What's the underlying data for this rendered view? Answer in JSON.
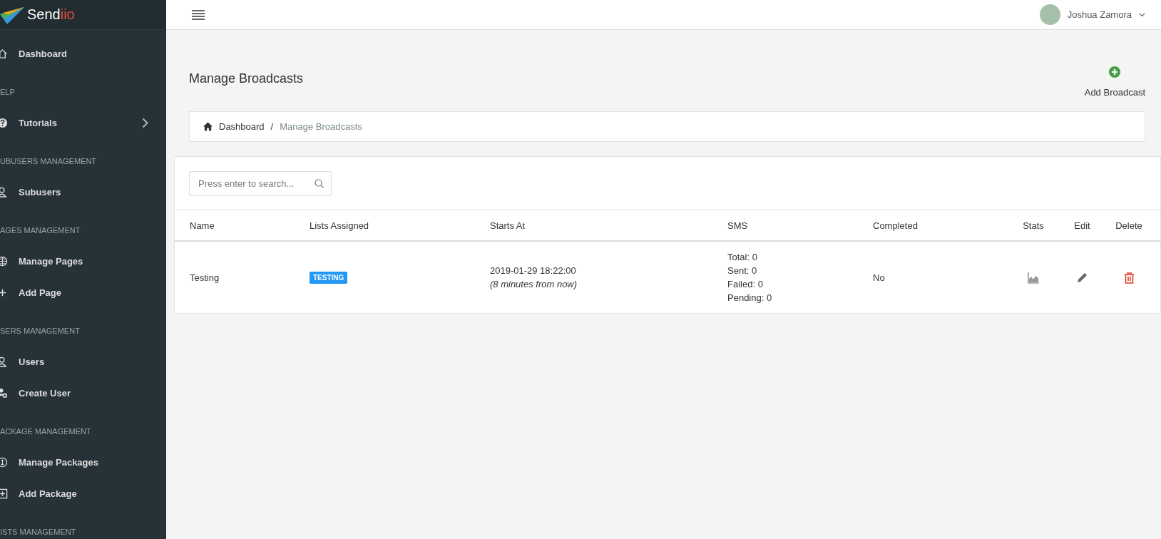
{
  "sidebar": {
    "logo": {
      "text": "Send",
      "accent": "iio"
    },
    "items": [
      {
        "kind": "item",
        "label": "Dashboard",
        "submenu": false
      },
      {
        "kind": "header",
        "label": "ELP"
      },
      {
        "kind": "item",
        "label": "Tutorials",
        "submenu": true
      },
      {
        "kind": "header",
        "label": "UBUSERS MANAGEMENT"
      },
      {
        "kind": "item",
        "label": "Subusers",
        "submenu": false
      },
      {
        "kind": "header",
        "label": "AGES MANAGEMENT"
      },
      {
        "kind": "item",
        "label": "Manage Pages",
        "submenu": false
      },
      {
        "kind": "item",
        "label": "Add Page",
        "submenu": false
      },
      {
        "kind": "header",
        "label": "SERS MANAGEMENT"
      },
      {
        "kind": "item",
        "label": "Users",
        "submenu": false
      },
      {
        "kind": "item",
        "label": "Create User",
        "submenu": false
      },
      {
        "kind": "header",
        "label": "ACKAGE MANAGEMENT"
      },
      {
        "kind": "item",
        "label": "Manage Packages",
        "submenu": false
      },
      {
        "kind": "item",
        "label": "Add Package",
        "submenu": false
      },
      {
        "kind": "header",
        "label": "ISTS MANAGEMENT"
      }
    ]
  },
  "topbar": {
    "user": "Joshua Zamora"
  },
  "page": {
    "title": "Manage Broadcasts",
    "add_button": "Add Broadcast",
    "breadcrumb": {
      "items": [
        "Dashboard",
        "Manage Broadcasts"
      ],
      "separator": "/"
    },
    "search": {
      "placeholder": "Press enter to search..."
    },
    "table": {
      "columns": [
        "Name",
        "Lists Assigned",
        "Starts At",
        "SMS",
        "Completed",
        "Stats",
        "Edit",
        "Delete"
      ],
      "rows": [
        {
          "name": "Testing",
          "lists": [
            "TESTING"
          ],
          "starts_at": "2019-01-29 18:22:00",
          "starts_relative": "(8 minutes from now)",
          "sms": [
            "Total: 0",
            "Sent: 0",
            "Failed: 0",
            "Pending: 0"
          ],
          "completed": "No"
        }
      ]
    }
  }
}
